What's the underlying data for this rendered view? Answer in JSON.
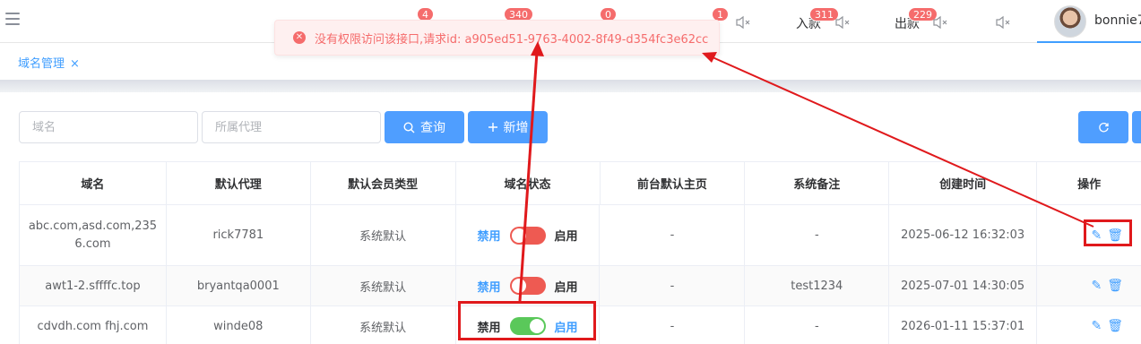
{
  "topbar": {
    "nav": [
      {
        "label": "",
        "badge": "4"
      },
      {
        "label": "",
        "badge": "340"
      },
      {
        "label": "",
        "badge": "0"
      },
      {
        "label": "",
        "badge": "1"
      },
      {
        "label": "入款",
        "badge": "311"
      },
      {
        "label": "出款",
        "badge": "229"
      }
    ],
    "username": "bonnie7"
  },
  "tabs": {
    "active": "域名管理",
    "close": "×"
  },
  "filters": {
    "domain_placeholder": "域名",
    "agent_placeholder": "所属代理",
    "search_label": "查询",
    "add_label": "新增"
  },
  "table": {
    "headers": [
      "域名",
      "默认代理",
      "默认会员类型",
      "域名状态",
      "前台默认主页",
      "系统备注",
      "创建时间",
      "操作"
    ],
    "status_off": "禁用",
    "status_on": "启用",
    "rows": [
      {
        "domain": "abc.com,asd.com,2356.com",
        "agent": "rick7781",
        "member_type": "系统默认",
        "enabled": false,
        "homepage": "-",
        "remark": "-",
        "created": "2025-06-12 16:32:03"
      },
      {
        "domain": "awt1-2.sffffc.top",
        "agent": "bryantqa0001",
        "member_type": "系统默认",
        "enabled": false,
        "homepage": "-",
        "remark": "test1234",
        "created": "2025-07-01 14:30:05"
      },
      {
        "domain": "cdvdh.com fhj.com",
        "agent": "winde08",
        "member_type": "系统默认",
        "enabled": true,
        "homepage": "-",
        "remark": "-",
        "created": "2026-01-11 15:37:01"
      }
    ]
  },
  "error_message": "没有权限访问该接口,请求id: a905ed51-9763-4002-8f49-d354fc3e62cc",
  "colors": {
    "primary": "#409eff",
    "danger": "#f56c6c",
    "switch_on": "#5ac85a",
    "switch_off": "#ee5a52",
    "annotation": "#e0191c"
  }
}
